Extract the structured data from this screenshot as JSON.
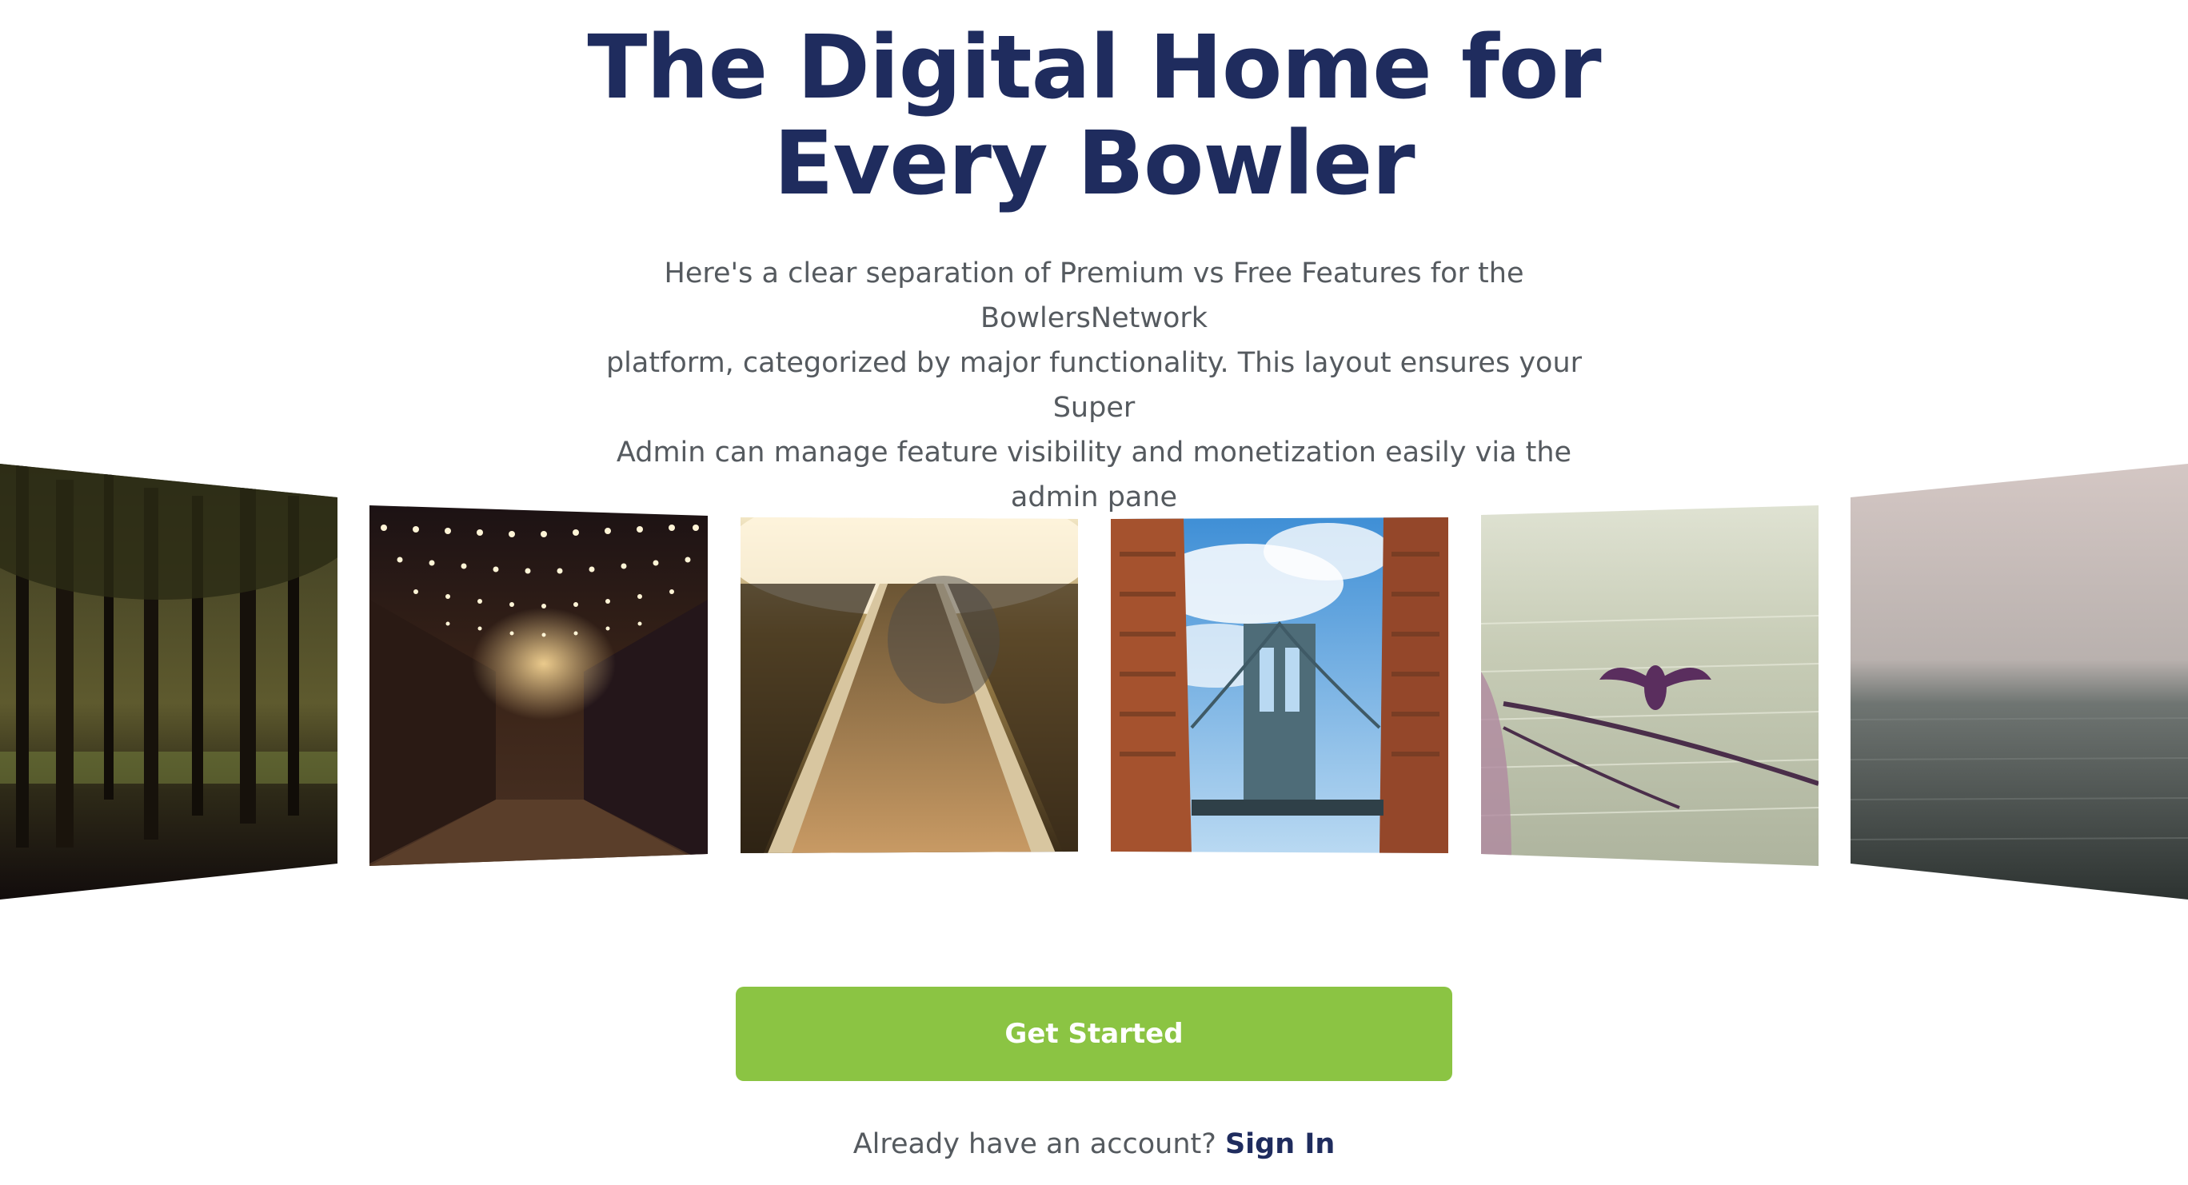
{
  "hero": {
    "title_line1": "The Digital Home for",
    "title_line2": "Every Bowler",
    "subtitle_line1": "Here's a clear separation of Premium vs Free Features for the BowlersNetwork",
    "subtitle_line2": "platform, categorized by major functionality. This layout ensures your Super",
    "subtitle_line3": "Admin can manage feature visibility and monetization easily via the admin pane"
  },
  "gallery": {
    "images": [
      {
        "subject": "trees-at-dusk"
      },
      {
        "subject": "street-with-string-lights"
      },
      {
        "subject": "escalator-in-tunnel"
      },
      {
        "subject": "bridge-between-buildings"
      },
      {
        "subject": "bird-on-rope-over-water"
      },
      {
        "subject": "misty-sea"
      }
    ]
  },
  "cta": {
    "button_label": "Get Started",
    "button_color": "#8bc443"
  },
  "signin": {
    "prompt": "Already have an account?",
    "link_label": "Sign In"
  },
  "colors": {
    "heading": "#1f2c5e",
    "body_text": "#555a5f",
    "accent": "#8bc443"
  }
}
